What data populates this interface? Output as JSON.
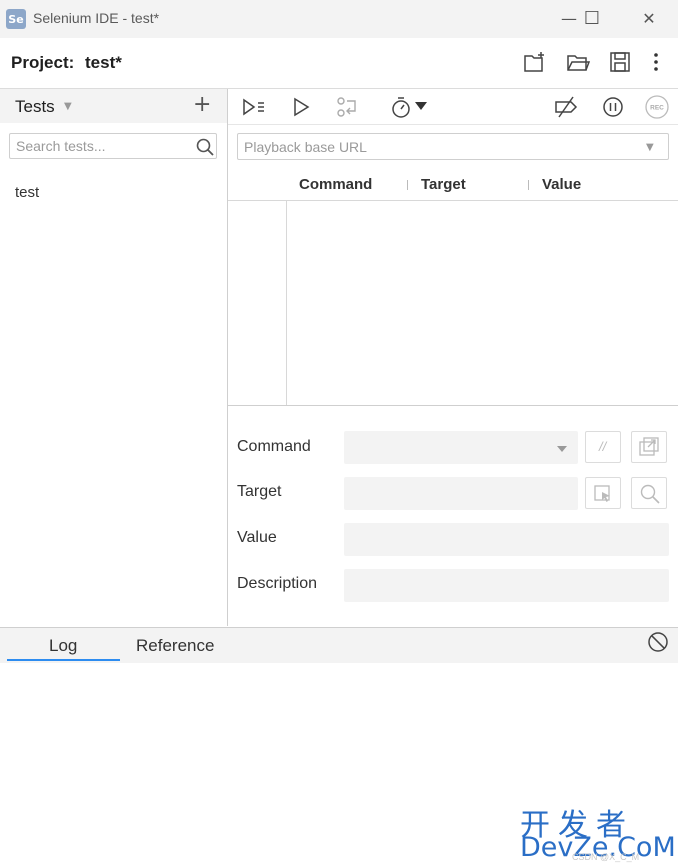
{
  "window": {
    "logo": "Se",
    "title": "Selenium IDE - test*",
    "minimize": "—",
    "maximize": "☐",
    "close": "✕"
  },
  "project": {
    "label": "Project:",
    "name": "test*"
  },
  "tests_panel": {
    "header": "Tests",
    "caret": "▼",
    "add": "+",
    "search_placeholder": "Search tests...",
    "items": [
      "test"
    ]
  },
  "playback": {
    "url_placeholder": "Playback base URL",
    "caret": "▼"
  },
  "table": {
    "columns": [
      "Command",
      "Target",
      "Value"
    ]
  },
  "editor": {
    "command_label": "Command",
    "target_label": "Target",
    "value_label": "Value",
    "description_label": "Description",
    "comment_glyph": "//"
  },
  "bottom": {
    "tabs": [
      "Log",
      "Reference"
    ]
  },
  "watermark": {
    "zh": "开发者",
    "en": "DevZe.CoM",
    "sub": "CSDN @X_C_M"
  },
  "colors": {
    "accent": "#2d8cf0",
    "watermark": "#2a6ec6"
  }
}
